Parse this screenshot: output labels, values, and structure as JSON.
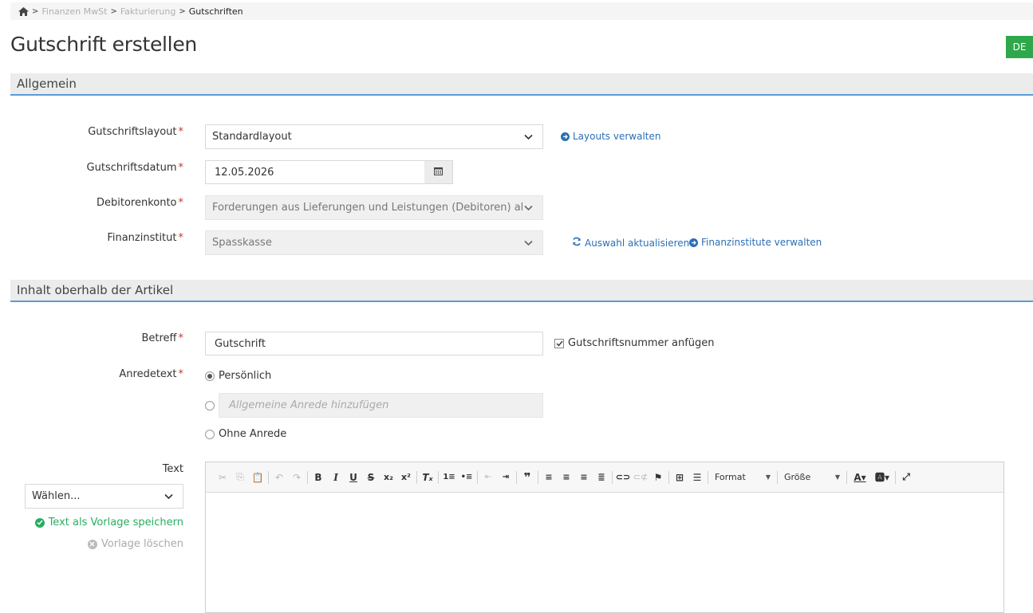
{
  "breadcrumb": {
    "items": [
      "Finanzen MwSt",
      "Fakturierung",
      "Gutschriften"
    ]
  },
  "page": {
    "title": "Gutschrift erstellen",
    "language": "DE"
  },
  "sections": {
    "general": "Allgemein",
    "content_above": "Inhalt oberhalb der Artikel"
  },
  "form": {
    "layout": {
      "label": "Gutschriftslayout",
      "value": "Standardlayout",
      "link": "Layouts verwalten"
    },
    "date": {
      "label": "Gutschriftsdatum",
      "value": "12.05.2026"
    },
    "debtor": {
      "label": "Debitorenkonto",
      "value": "Forderungen aus Lieferungen und Leistungen (Debitoren) allgem..."
    },
    "bank": {
      "label": "Finanzinstitut",
      "value": "Spasskasse",
      "refresh_link": "Auswahl aktualisieren",
      "manage_link": "Finanzinstitute verwalten"
    },
    "subject": {
      "label": "Betreff",
      "value": "Gutschrift",
      "append_number": "Gutschriftsnummer anfügen",
      "append_checked": true
    },
    "salutation": {
      "label": "Anredetext",
      "personal": "Persönlich",
      "general_placeholder": "Allgemeine Anrede hinzufügen",
      "none": "Ohne Anrede",
      "selected": "personal"
    },
    "text": {
      "label": "Text",
      "template_select": "Wählen...",
      "save_template": "Text als Vorlage speichern",
      "delete_template": "Vorlage löschen"
    }
  },
  "editor": {
    "format_label": "Format",
    "size_label": "Größe"
  },
  "colors": {
    "accent": "#5b9bd5",
    "link": "#2b6fb6",
    "success": "#27ae60",
    "required": "#c0392b",
    "badge": "#2ea84a"
  }
}
